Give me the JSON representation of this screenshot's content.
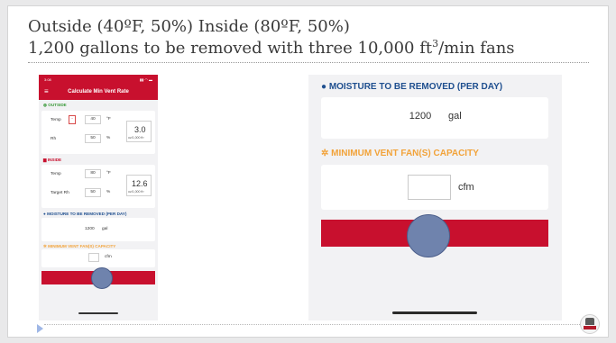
{
  "slide": {
    "title_line1": "Outside (40ºF, 50%) Inside (80ºF, 50%)",
    "title_line2_a": "1,200 gallons to be removed with three 10,000 ft",
    "title_line2_sup": "3",
    "title_line2_b": "/min fans"
  },
  "phone": {
    "status_time": "3:08",
    "status_icons": "▮▮ ◠ ▬",
    "menu_icon": "≡",
    "nav_title": "Calculate Min Vent Rate",
    "outside": {
      "heading": "◍ OUTSIDE",
      "temp_label": "Temp",
      "temp_minus": "-",
      "temp_value": "40",
      "temp_unit": "°F",
      "rh_label": "Rh",
      "rh_value": "50",
      "rh_unit": "%",
      "result_value": "3.0",
      "result_unit": "oz/1,000 ft³"
    },
    "inside": {
      "heading": "▆ INSIDE",
      "temp_label": "Temp",
      "temp_value": "80",
      "temp_unit": "°F",
      "rh_label": "Target Rh",
      "rh_value": "50",
      "rh_unit": "%",
      "result_value": "12.6",
      "result_unit": "oz/1,000 ft³"
    },
    "moisture": {
      "heading": "MOISTURE TO BE REMOVED (PER DAY)",
      "value": "1200",
      "unit": "gal"
    },
    "vent": {
      "heading": "MINIMUM VENT FAN(S) CAPACITY",
      "value": "",
      "unit": "cfm"
    }
  },
  "tablet": {
    "moisture_icon": "drop-icon",
    "moisture_heading": "MOISTURE TO BE REMOVED (PER DAY)",
    "moisture_value": "1200",
    "moisture_unit": "gal",
    "vent_icon": "fan-icon",
    "vent_heading": "MINIMUM VENT FAN(S) CAPACITY",
    "vent_value": "",
    "vent_unit": "cfm"
  },
  "colors": {
    "brand_red": "#c8102e",
    "outside_green": "#3a9a3a",
    "moisture_blue": "#1f4f8f",
    "vent_orange": "#f2a33a",
    "overlay_circle": "#6f83ad"
  },
  "logo": {
    "text": "GEORGIA"
  }
}
